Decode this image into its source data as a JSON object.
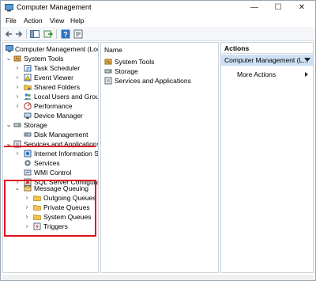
{
  "window": {
    "title": "Computer Management",
    "controls": {
      "minimize": "—",
      "maximize": "☐",
      "close": "✕"
    }
  },
  "menu": [
    "File",
    "Action",
    "View",
    "Help"
  ],
  "toolbar_icons": [
    "back-icon",
    "forward-icon",
    "console-tree-icon",
    "export-list-icon",
    "help-icon",
    "properties-icon"
  ],
  "tree": {
    "root": "Computer Management (Local",
    "system_tools": {
      "label": "System Tools",
      "children": [
        "Task Scheduler",
        "Event Viewer",
        "Shared Folders",
        "Local Users and Groups",
        "Performance",
        "Device Manager"
      ]
    },
    "storage": {
      "label": "Storage",
      "children": [
        "Disk Management"
      ]
    },
    "services_apps": {
      "label": "Services and Applications",
      "children": [
        "Internet Information Ser",
        "Services",
        "WMI Control",
        "SQL Server Configurati"
      ]
    },
    "message_queuing": {
      "label": "Message Queuing",
      "children": [
        "Outgoing Queues",
        "Private Queues",
        "System Queues",
        "Triggers"
      ]
    }
  },
  "center": {
    "column_header": "Name",
    "items": [
      "System Tools",
      "Storage",
      "Services and Applications"
    ]
  },
  "actions": {
    "header": "Actions",
    "selected": "Computer Management (L...",
    "more": "More Actions"
  },
  "colors": {
    "annotation": "#e0101a",
    "selection": "#cde0f5"
  }
}
